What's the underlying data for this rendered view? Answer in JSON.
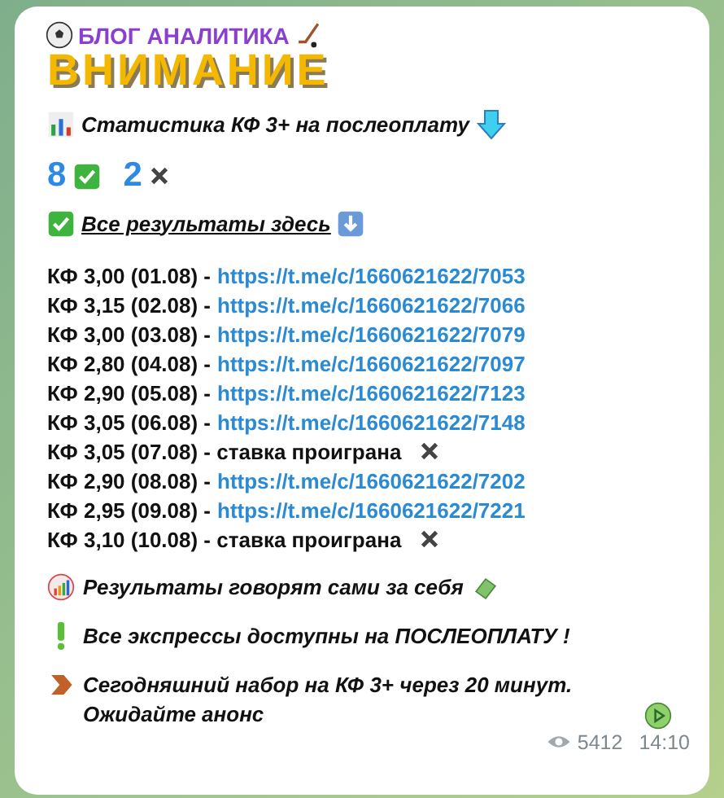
{
  "header": {
    "brand": "БЛОГ АНАЛИТИКА",
    "banner": "ВНИМАНИЕ"
  },
  "stats_title": "Статистика КФ 3+ на послеоплату",
  "counts": [
    {
      "value": "8",
      "kind": "win"
    },
    {
      "value": "2",
      "kind": "loss"
    }
  ],
  "results_link": "Все результаты здесь",
  "bets": [
    {
      "label": "КФ 3,00 (01.08) -",
      "kind": "link",
      "link": "https://t.me/c/1660621622/7053"
    },
    {
      "label": "КФ 3,15 (02.08) -",
      "kind": "link",
      "link": "https://t.me/c/1660621622/7066"
    },
    {
      "label": "КФ 3,00 (03.08) -",
      "kind": "link",
      "link": "https://t.me/c/1660621622/7079"
    },
    {
      "label": "КФ 2,80 (04.08) -",
      "kind": "link",
      "link": "https://t.me/c/1660621622/7097"
    },
    {
      "label": "КФ 2,90 (05.08) -",
      "kind": "link",
      "link": "https://t.me/c/1660621622/7123"
    },
    {
      "label": "КФ 3,05 (06.08) -",
      "kind": "link",
      "link": "https://t.me/c/1660621622/7148"
    },
    {
      "label": "КФ 3,05 (07.08) - ставка проиграна",
      "kind": "lost"
    },
    {
      "label": "КФ 2,90 (08.08) -",
      "kind": "link",
      "link": "https://t.me/c/1660621622/7202"
    },
    {
      "label": "КФ 2,95 (09.08) -",
      "kind": "link",
      "link": "https://t.me/c/1660621622/7221"
    },
    {
      "label": "КФ 3,10 (10.08) - ставка проиграна",
      "kind": "lost"
    }
  ],
  "notes": [
    {
      "text": "Результаты говорят сами за себя",
      "kind": "results"
    },
    {
      "text": "Все экспрессы доступны на ПОСЛЕОПЛАТУ !",
      "kind": "express"
    },
    {
      "text": "Сегодняшний набор на КФ 3+ через 20 минут. Ожидайте анонс",
      "kind": "announce"
    }
  ],
  "footer": {
    "views": "5412",
    "time": "14:10"
  }
}
